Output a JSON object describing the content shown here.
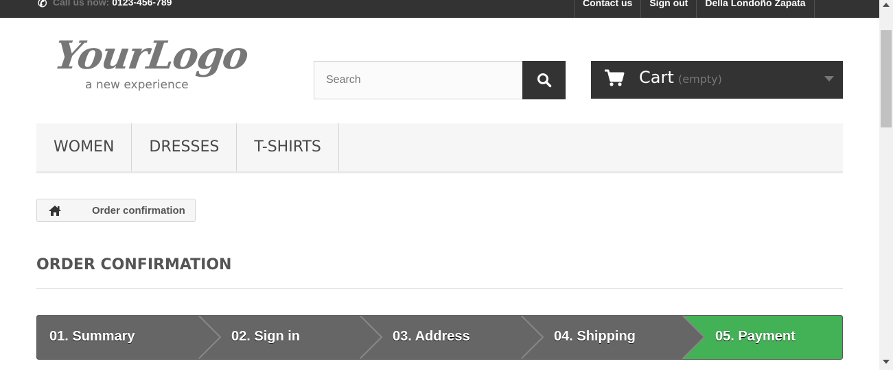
{
  "topbar": {
    "call_label": "Call us now:",
    "phone": "0123-456-789",
    "links": [
      "Contact us",
      "Sign out",
      "Della Londoño Zapata"
    ]
  },
  "logo": {
    "main": "YourLogo",
    "tagline": "a new experience"
  },
  "search": {
    "placeholder": "Search",
    "value": ""
  },
  "cart": {
    "label": "Cart",
    "quantity": "(empty)"
  },
  "menu": {
    "items": [
      "WOMEN",
      "DRESSES",
      "T-SHIRTS"
    ]
  },
  "breadcrumb": {
    "current": "Order confirmation"
  },
  "page": {
    "title": "ORDER CONFIRMATION"
  },
  "steps": {
    "items": [
      "01. Summary",
      "02. Sign in",
      "03. Address",
      "04. Shipping",
      "05. Payment"
    ],
    "active_index": 4
  },
  "colors": {
    "dark": "#333333",
    "step_inactive": "#666666",
    "step_active": "#43b155",
    "menu_bg": "#f6f6f6"
  },
  "icons": [
    "phone-icon",
    "search-icon",
    "cart-icon",
    "chevron-down-icon",
    "home-icon"
  ]
}
